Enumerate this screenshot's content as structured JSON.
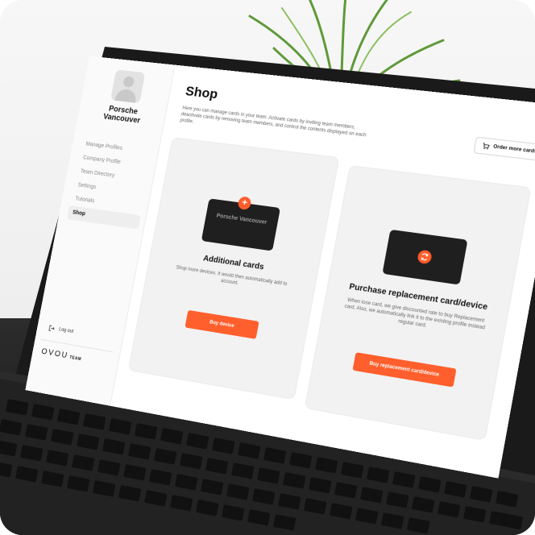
{
  "org": {
    "name": "Porsche Vancouver"
  },
  "sidebar": {
    "items": [
      {
        "label": "Manage Profiles"
      },
      {
        "label": "Company Profile"
      },
      {
        "label": "Team Directory"
      },
      {
        "label": "Settings"
      },
      {
        "label": "Tutorials"
      },
      {
        "label": "Shop",
        "active": true
      }
    ],
    "logout_label": "Log out",
    "brand_name": "OVOU",
    "brand_suffix": "TEAM"
  },
  "header": {
    "title": "Shop",
    "description": "Here you can manage cards in your team. Activate cards by inviting team members, deactivate cards by removing team members, and control the contents displayed on each profile.",
    "order_button_label": "Order more cards",
    "order_icon": "cart-icon"
  },
  "cards": [
    {
      "card_text": "Porsche Vancouver",
      "badge_icon": "plus-icon",
      "title": "Additional cards",
      "description": "Shop more devices. It would then automatically add to account.",
      "button_label": "Buy device"
    },
    {
      "badge_icon": "refresh-icon",
      "title": "Purchase replacement card/device",
      "description": "When lose card, we give discounted rate to buy Replacement card. Also, we automatically link it to the existing profile instead regular card.",
      "button_label": "Buy replacement card/device"
    }
  ],
  "colors": {
    "accent": "#ff5f2d",
    "card_dark": "#1f1f1f",
    "panel_bg": "#f2f2f2"
  }
}
